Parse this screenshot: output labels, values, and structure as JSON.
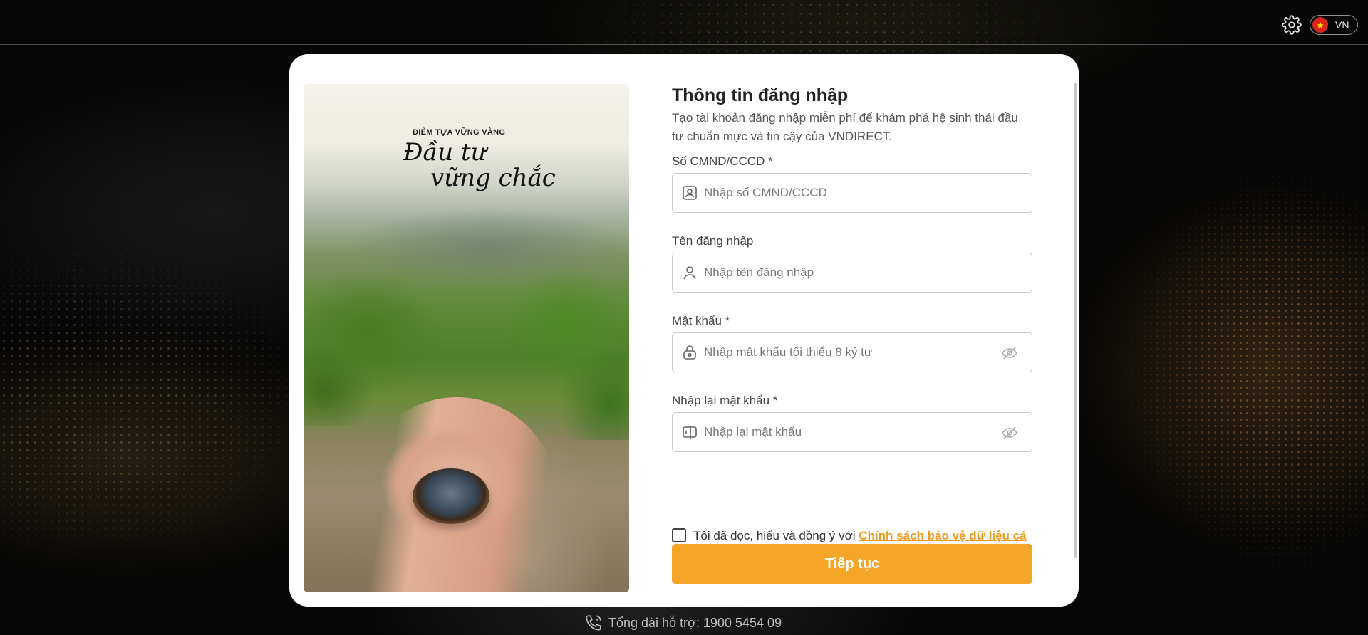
{
  "topbar": {
    "language_code": "VN",
    "flag_symbol": "★",
    "settings_icon": "gear-icon"
  },
  "promo": {
    "kicker": "ĐIỂM TỰA VỮNG VÀNG",
    "title_line1": "Đầu tư",
    "title_line2": "vững chắc"
  },
  "form": {
    "title": "Thông tin đăng nhập",
    "description": "Tạo tài khoản đăng nhập miễn phí để khám phá hệ sinh thái đầu tư chuẩn mực và tin cậy của VNDIRECT.",
    "fields": [
      {
        "label": "Số CMND/CCCD *",
        "placeholder": "Nhập số CMND/CCCD",
        "icon": "id-card-icon"
      },
      {
        "label": "Tên đăng nhập",
        "placeholder": "Nhập tên đăng nhập",
        "icon": "user-icon"
      },
      {
        "label": "Mật khẩu *",
        "placeholder": "Nhập mật khẩu tối thiểu 8 ký tự",
        "icon": "lock-icon"
      },
      {
        "label": "Nhập lại mật khẩu *",
        "placeholder": "Nhập lại mật khẩu",
        "icon": "password-confirm-icon"
      }
    ],
    "consent_text": "Tôi đã đọc, hiểu và đồng ý với ",
    "consent_link": "Chính sách bảo vệ dữ liệu cá nhân của VNDIRECT",
    "submit_label": "Tiếp tục"
  },
  "footer": {
    "support_text": "Tổng đài hỗ trợ: 1900 5454 09"
  },
  "colors": {
    "accent": "#f6a627",
    "link": "#f29c1f",
    "background": "#060606"
  }
}
